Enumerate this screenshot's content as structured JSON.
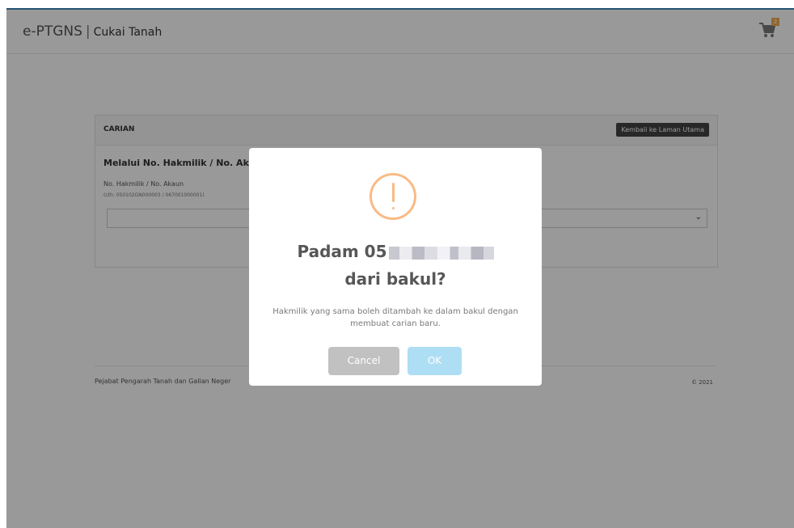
{
  "navbar": {
    "brand": "e-PTGNS",
    "separator": "|",
    "subtitle": "Cukai Tanah",
    "cart_count": "2",
    "cart_icon": "cart-icon"
  },
  "panel": {
    "title": "CARIAN",
    "back_button": "Kembali ke Laman Utama",
    "section_title": "Melalui No. Hakmilik / No. Aka",
    "field_label": "No. Hakmilik / No. Akaun",
    "field_hint": "(cth: 050102GN000003 / 067001000001)",
    "field_value": "",
    "chevron_icon": "chevron-down-icon"
  },
  "footer": {
    "left": "Pejabat Pengarah Tanah dan Galian Neger",
    "right": "© 2021"
  },
  "dialog": {
    "icon": "warning-icon",
    "title_prefix": "Padam 05",
    "title_suffix": "dari bakul?",
    "message": "Hakmilik yang sama boleh ditambah ke dalam bakul dengan membuat carian baru.",
    "cancel_label": "Cancel",
    "ok_label": "OK"
  },
  "colors": {
    "overlay": "#000000",
    "warning": "#f8bb86",
    "ok_button": "#aedef4",
    "cancel_button": "#c1c1c1"
  }
}
